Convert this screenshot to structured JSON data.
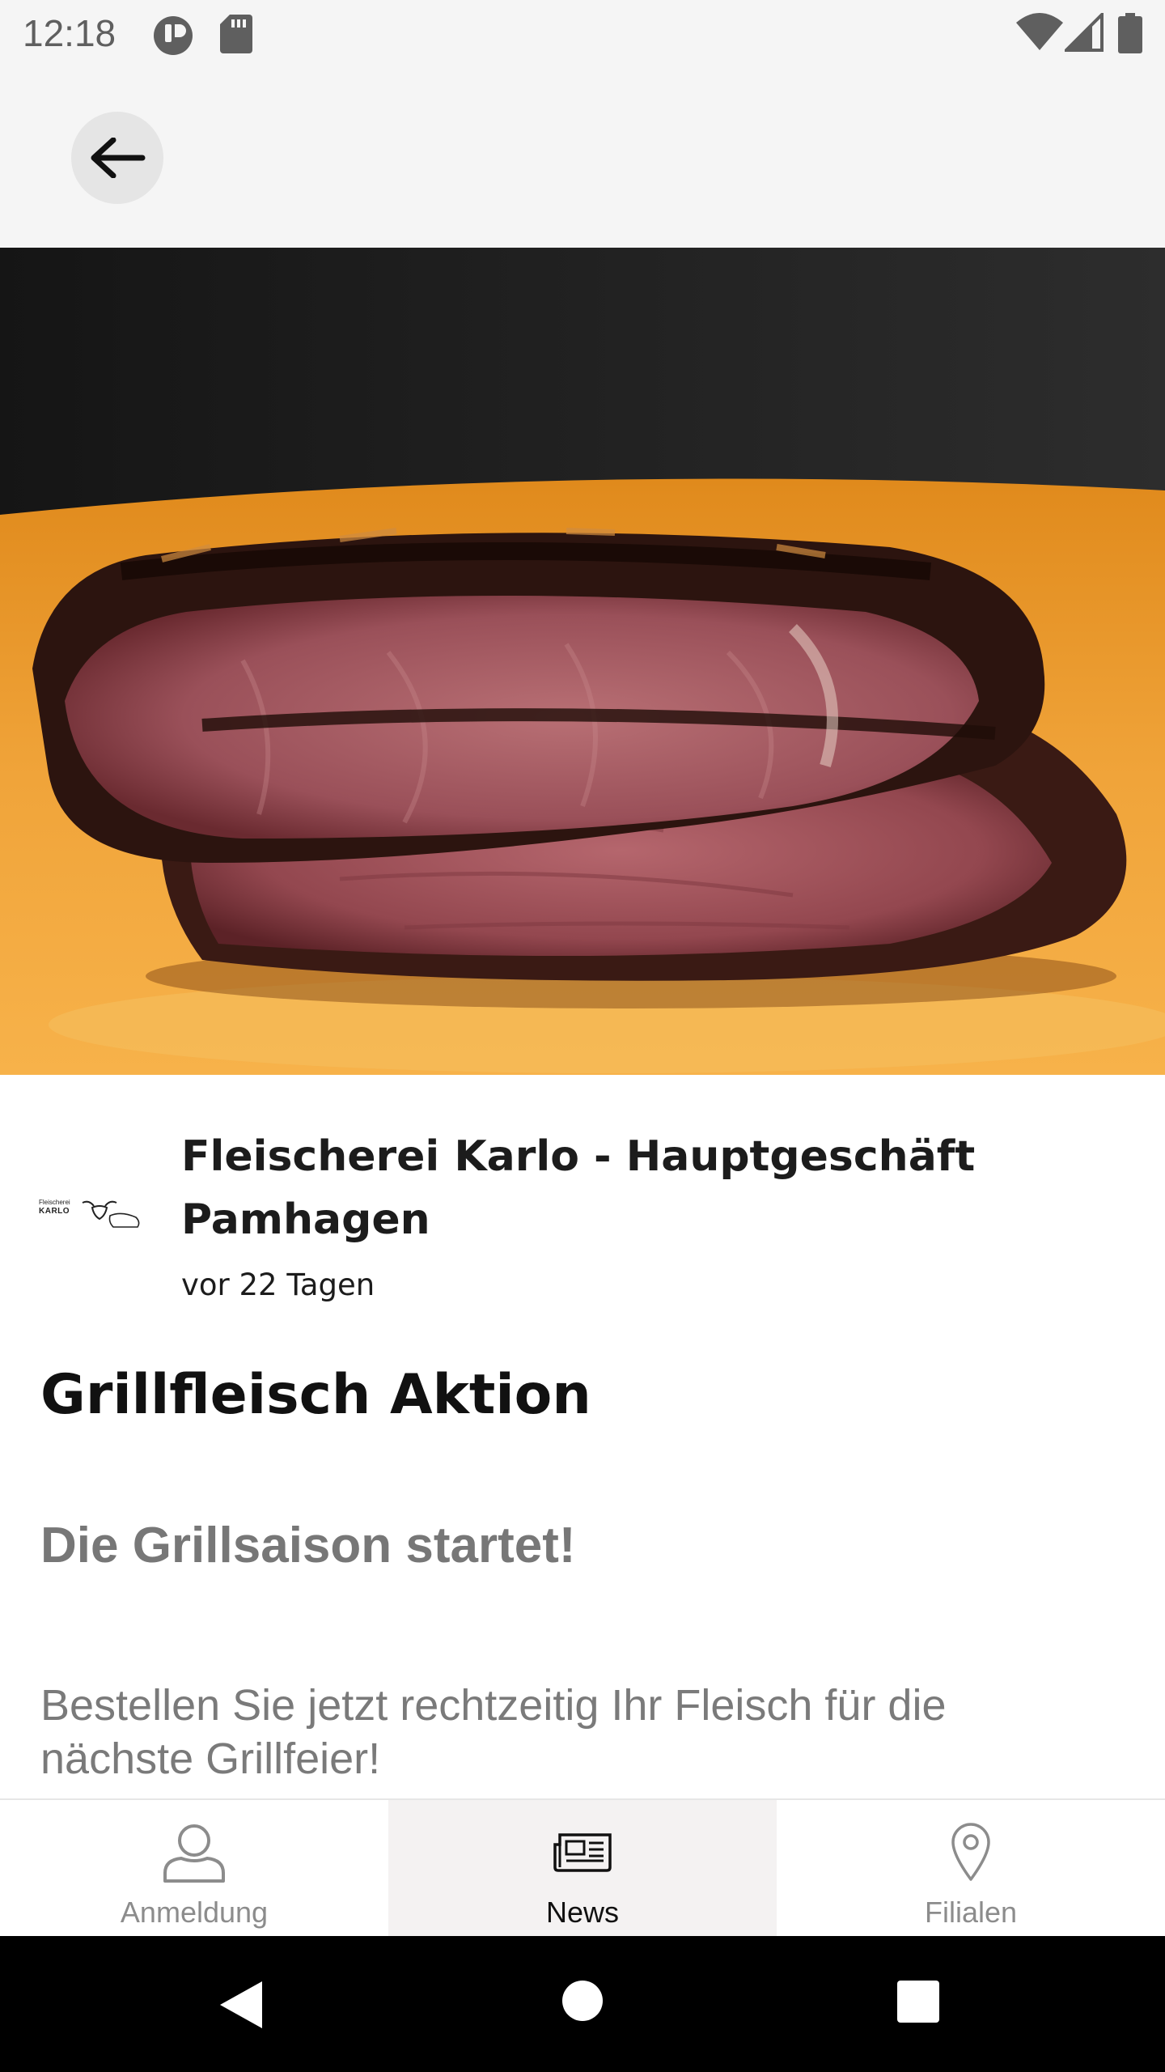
{
  "status_bar": {
    "time": "12:18",
    "icons": [
      "app-notification-icon",
      "sd-card-icon",
      "wifi-icon",
      "signal-icon",
      "battery-icon"
    ]
  },
  "header": {
    "back_icon": "arrow-left-icon"
  },
  "post": {
    "shop_name": "Fleischerei Karlo - Hauptgeschäft Pamhagen",
    "age": "vor 22 Tagen",
    "title": "Grillfleisch Aktion",
    "subtitle": "Die Grillsaison startet!",
    "body": "Bestellen Sie jetzt rechtzeitig Ihr Fleisch für die nächste Grillfeier!",
    "logo_text": {
      "line1": "Fleischerei",
      "line2": "KARLO"
    }
  },
  "bottom_nav": {
    "items": [
      {
        "label": "Anmeldung",
        "icon": "person-icon",
        "active": false
      },
      {
        "label": "News",
        "icon": "newspaper-icon",
        "active": true
      },
      {
        "label": "Filialen",
        "icon": "location-pin-icon",
        "active": false
      }
    ]
  },
  "system_nav": {
    "icons": [
      "back-triangle-icon",
      "home-circle-icon",
      "recents-square-icon"
    ]
  },
  "colors": {
    "header_bg": "#f5f5f5",
    "active_tab_bg": "#f4f2f2",
    "muted_text": "#7a7a7a",
    "inactive_nav": "#8c8c8c"
  }
}
